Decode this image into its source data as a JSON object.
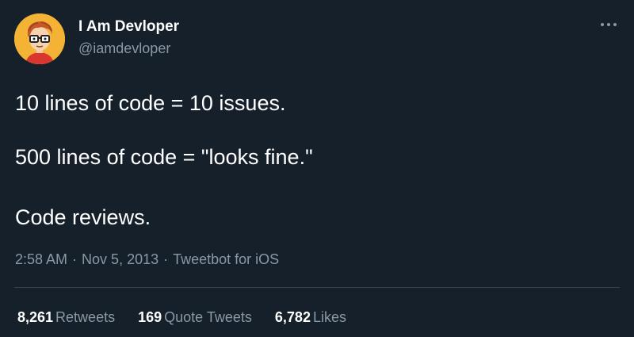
{
  "tweet": {
    "author": {
      "display_name": "I Am Devloper",
      "handle": "@iamdevloper"
    },
    "text_lines": [
      "10 lines of code = 10 issues.",
      "500 lines of code = \"looks fine.\"",
      "Code reviews."
    ],
    "meta": {
      "time": "2:58 AM",
      "separator": "·",
      "date": "Nov 5, 2013",
      "source": "Tweetbot for iOS"
    },
    "stats": [
      {
        "count": "8,261",
        "label": "Retweets"
      },
      {
        "count": "169",
        "label": "Quote Tweets"
      },
      {
        "count": "6,782",
        "label": "Likes"
      }
    ]
  },
  "colors": {
    "background": "#15202b",
    "text_primary": "#ffffff",
    "text_secondary": "#8b98a5",
    "divider": "#38444d",
    "avatar_bg": "#f5b335"
  },
  "icons": {
    "more": "more-horizontal-icon"
  }
}
